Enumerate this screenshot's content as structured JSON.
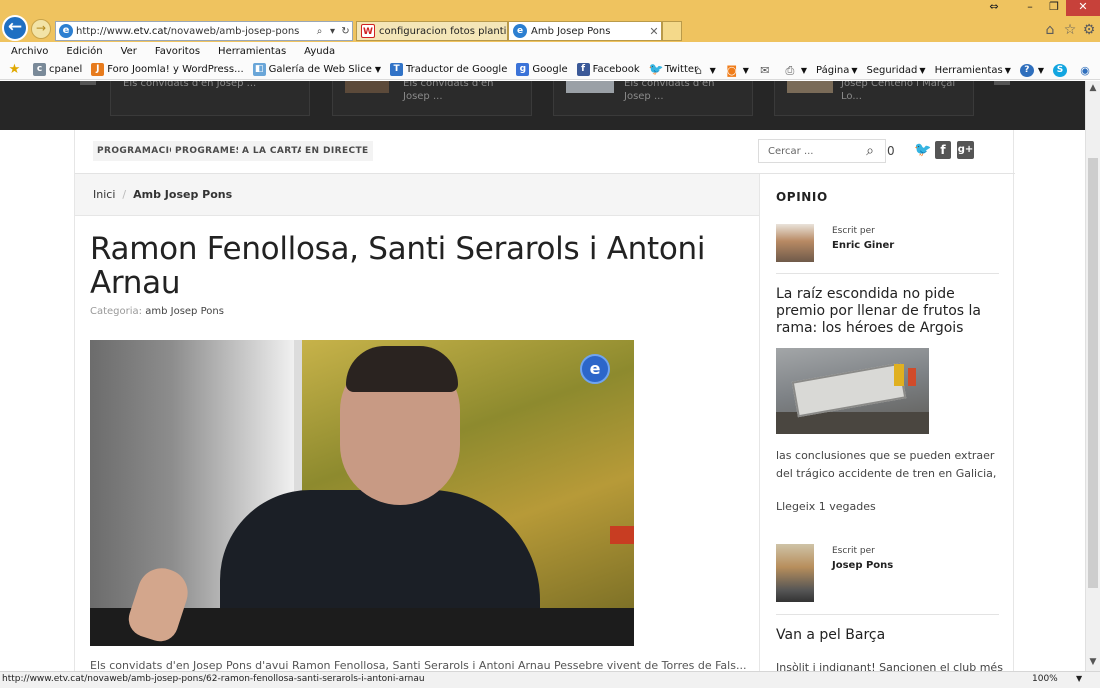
{
  "browser": {
    "url_prefix": "http://www.",
    "url_domain": "etv.cat",
    "url_path": "/novaweb/amb-josep-pons",
    "tabs": [
      {
        "label": "configuracion fotos plantilla g..."
      },
      {
        "label": "Amb Josep Pons",
        "close": "✕"
      }
    ],
    "menu": [
      "Archivo",
      "Edición",
      "Ver",
      "Favoritos",
      "Herramientas",
      "Ayuda"
    ],
    "favorites": [
      {
        "label": "cpanel",
        "icon": "cpanel-icon"
      },
      {
        "label": "Foro Joomla! y WordPress...",
        "icon": "joomla-icon"
      },
      {
        "label": "Galería de Web Slice",
        "icon": "web-slice-icon"
      },
      {
        "label": "Traductor de Google",
        "icon": "translate-icon"
      },
      {
        "label": "Google",
        "icon": "google-icon"
      },
      {
        "label": "Facebook",
        "icon": "facebook-icon"
      },
      {
        "label": "Twitter",
        "icon": "twitter-icon"
      }
    ],
    "commands": {
      "page": "Página",
      "security": "Seguridad",
      "tools": "Herramientas"
    },
    "status_url": "http://www.etv.cat/novaweb/amb-josep-pons/62-ramon-fenollosa-santi-serarols-i-antoni-arnau",
    "zoom": "100%"
  },
  "strip": {
    "cards": [
      {
        "text_1": "Els convidats d'en Josep ..."
      },
      {
        "text_1": "Els convidats d'en",
        "text_2": "Josep ..."
      },
      {
        "text_1": "Els convidats d'en",
        "text_2": "Josep ..."
      },
      {
        "text_1": "Josep Centeno i Marçal",
        "text_2": "Lo..."
      }
    ]
  },
  "nav": {
    "items": [
      "PROGRAMACIÓ",
      "PROGRAMES",
      "A LA CARTA",
      "EN DIRECTE"
    ],
    "search_placeholder": "Cercar ...",
    "search_count": "0"
  },
  "breadcrumb": {
    "home": "Inici",
    "separator": "/",
    "current": "Amb Josep Pons"
  },
  "article": {
    "title": "Ramon Fenollosa, Santi Serarols i Antoni Arnau",
    "category_label": "Categoria:",
    "category_value": "amb Josep Pons",
    "excerpt": "Els convidats d'en Josep Pons d'avui Ramon Fenollosa, Santi Serarols i Antoni Arnau Pessebre vivent de Torres de Fals..."
  },
  "sidebar": {
    "title": "OPINIO",
    "written_by": "Escrit per",
    "author_1": "Enric Giner",
    "opinion_1_title": "La raíz escondida no pide premio por llenar de frutos la rama: los héroes de Argois",
    "opinion_1_excerpt": "las conclusiones que se pueden extraer del trágico accidente de tren en Galicia,",
    "opinion_1_reads": "Llegeix 1 vegades",
    "author_2": "Josep Pons",
    "opinion_2_title": "Van a pel Barça",
    "opinion_2_excerpt": "Insòlit i indignant! Sancionen el club més"
  }
}
